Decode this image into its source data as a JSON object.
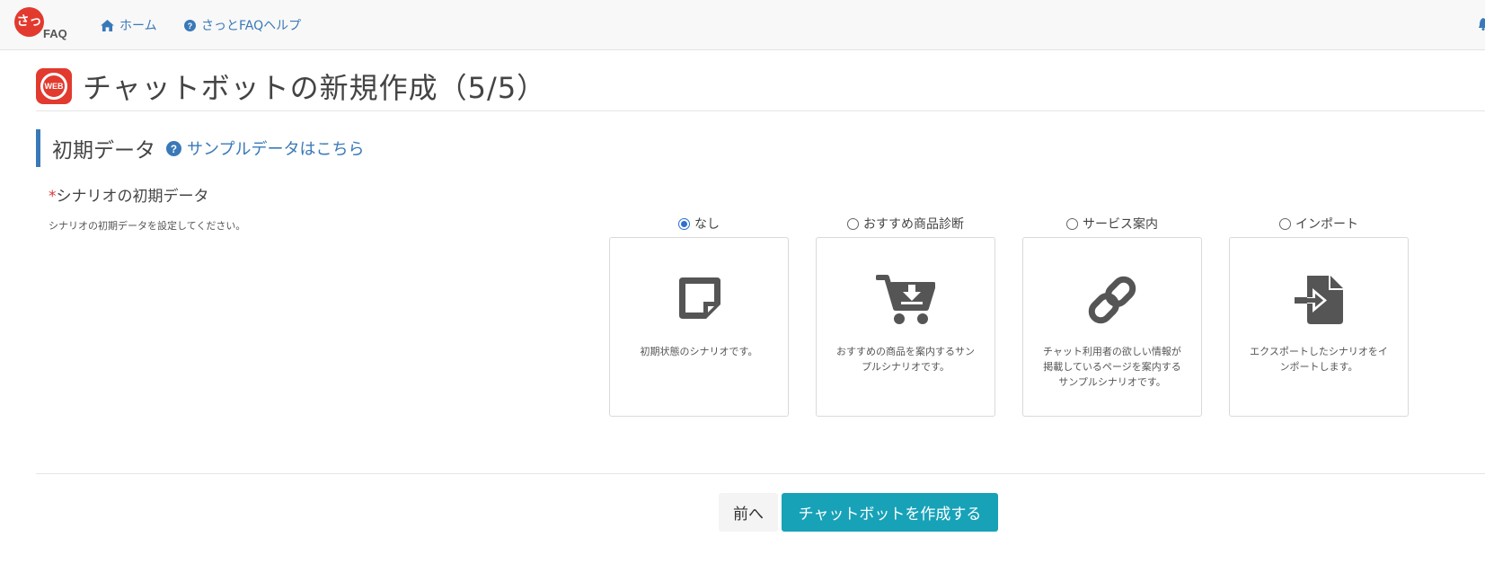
{
  "app": {
    "logo_text": "FAQ",
    "logo_mark": "さっ"
  },
  "nav": {
    "home_label": "ホーム",
    "help_label": "さっとFAQヘルプ"
  },
  "page": {
    "badge_text": "WEB",
    "title": "チャットボットの新規作成（5/5）"
  },
  "section": {
    "title": "初期データ",
    "sample_link": "サンプルデータはこちら"
  },
  "field": {
    "required_mark": "*",
    "label": "シナリオの初期データ",
    "help": "シナリオの初期データを設定してください。"
  },
  "options": [
    {
      "label": "なし",
      "checked": true,
      "description": "初期状態のシナリオです。",
      "icon": "sticky-note-icon"
    },
    {
      "label": "おすすめ商品診断",
      "checked": false,
      "description": "おすすめの商品を案内するサンプルシナリオです。",
      "icon": "cart-download-icon"
    },
    {
      "label": "サービス案内",
      "checked": false,
      "description": "チャット利用者の欲しい情報が掲載しているページを案内するサンプルシナリオです。",
      "icon": "link-icon"
    },
    {
      "label": "インポート",
      "checked": false,
      "description": "エクスポートしたシナリオをインポートします。",
      "icon": "file-import-icon"
    }
  ],
  "buttons": {
    "prev_label": "前へ",
    "create_label": "チャットボットを作成する"
  },
  "colors": {
    "brand_red": "#e23a2e",
    "link_blue": "#3a79b8",
    "primary_teal": "#17a2b8"
  }
}
